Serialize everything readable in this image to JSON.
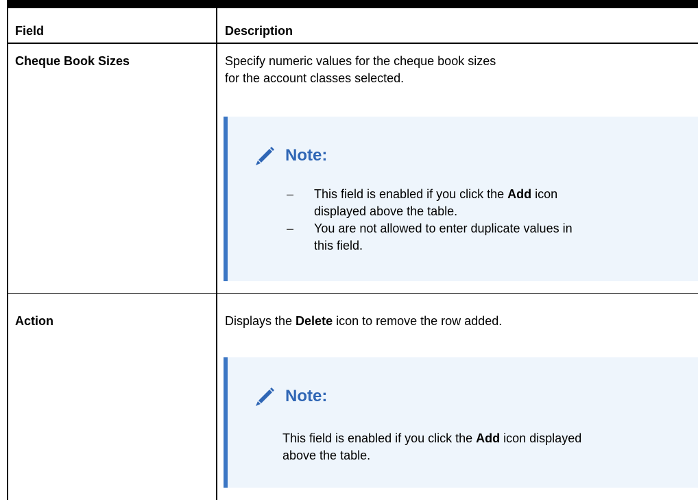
{
  "table": {
    "headers": {
      "field": "Field",
      "description": "Description"
    },
    "rows": [
      {
        "field": "Cheque Book Sizes",
        "description": "Specify numeric values for the cheque book sizes for the account classes selected.",
        "note": {
          "title": "Note:",
          "items": [
            {
              "before": "This field is enabled if you click the ",
              "bold": "Add",
              "after": " icon displayed above the table."
            },
            {
              "text": "You are not allowed to enter duplicate values in this field."
            }
          ]
        }
      },
      {
        "field": "Action",
        "description": {
          "before": "Displays the ",
          "bold": "Delete",
          "after": " icon to remove the row added."
        },
        "note": {
          "title": "Note:",
          "paragraph": {
            "before": "This field is enabled if you click the ",
            "bold": "Add",
            "after": " icon displayed above the table."
          }
        }
      }
    ]
  },
  "colors": {
    "note_background": "#eef5fc",
    "note_accent": "#3b76c4",
    "note_title": "#2f66b5"
  }
}
